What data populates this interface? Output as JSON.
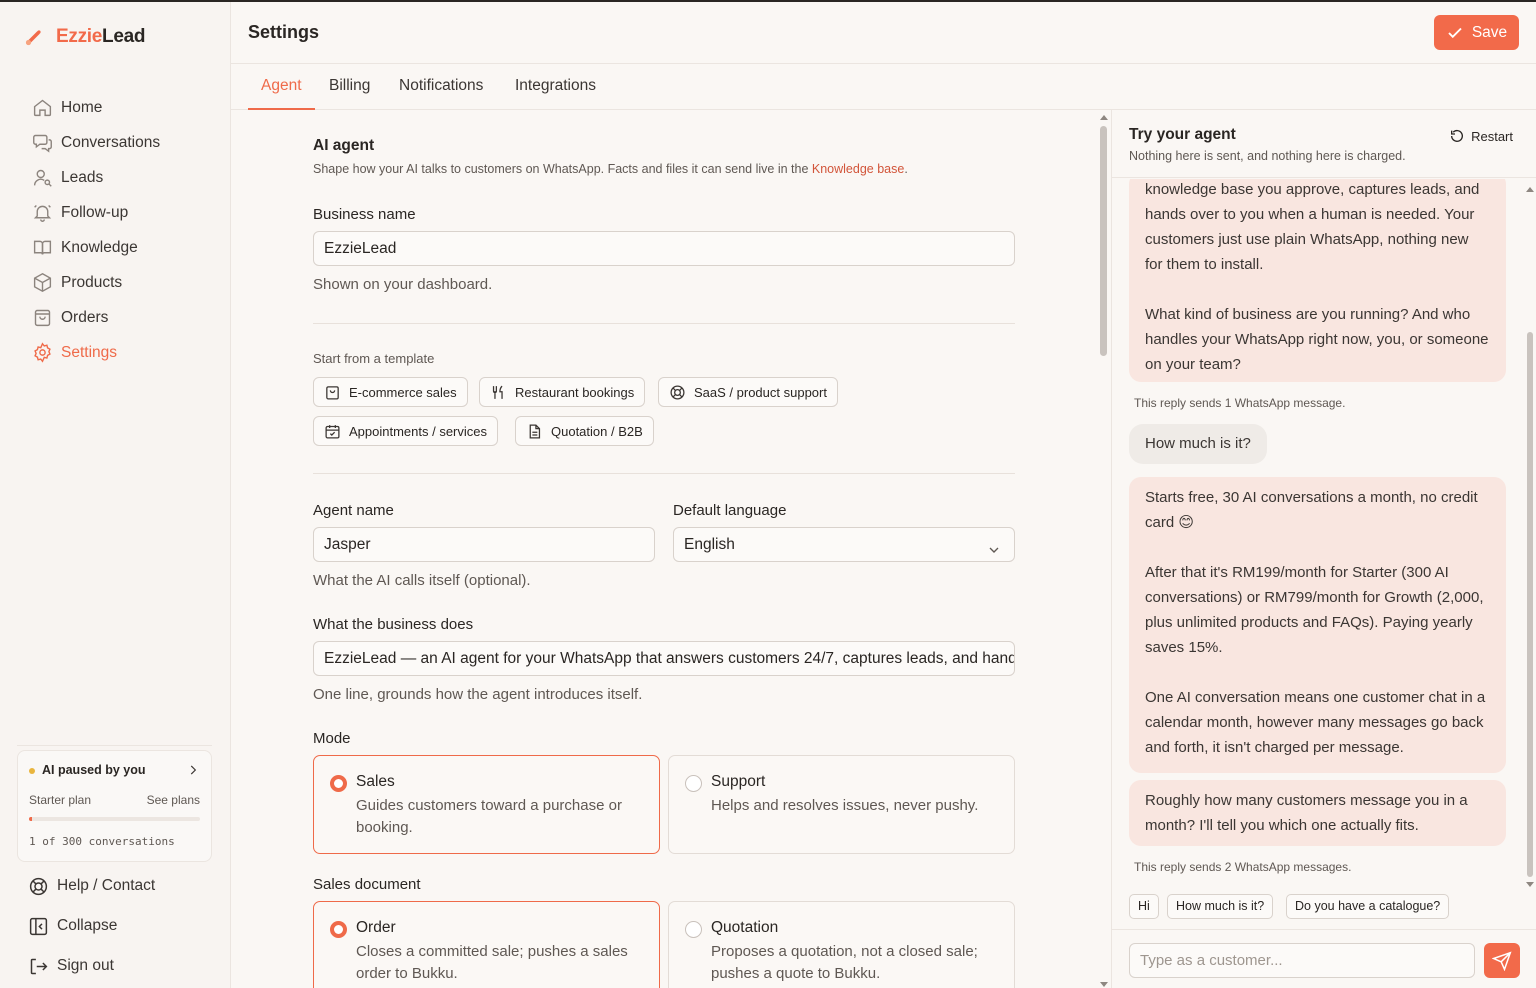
{
  "brand": {
    "name_part1": "Ezzie",
    "name_part2": "Lead",
    "accent": "#f26a4a"
  },
  "sidebar": {
    "items": [
      {
        "label": "Home",
        "icon": "home-icon"
      },
      {
        "label": "Conversations",
        "icon": "chat-icon"
      },
      {
        "label": "Leads",
        "icon": "user-search-icon"
      },
      {
        "label": "Follow-up",
        "icon": "bell-icon"
      },
      {
        "label": "Knowledge",
        "icon": "book-icon"
      },
      {
        "label": "Products",
        "icon": "box-icon"
      },
      {
        "label": "Orders",
        "icon": "bag-icon"
      },
      {
        "label": "Settings",
        "icon": "gear-icon",
        "active": true
      }
    ],
    "plan_card": {
      "status": "AI paused by you",
      "plan": "Starter plan",
      "see_plans": "See plans",
      "usage_text": "1 of 300 conversations",
      "usage_fraction": 0.0033
    },
    "bottom": [
      {
        "label": "Help / Contact",
        "icon": "lifebuoy-icon"
      },
      {
        "label": "Collapse",
        "icon": "collapse-icon"
      },
      {
        "label": "Sign out",
        "icon": "sign-out-icon"
      }
    ]
  },
  "header": {
    "title": "Settings",
    "save_label": "Save"
  },
  "tabs": [
    "Agent",
    "Billing",
    "Notifications",
    "Integrations"
  ],
  "form": {
    "section_title": "AI agent",
    "section_desc": "Shape how your AI talks to customers on WhatsApp. Facts and files it can send live in the ",
    "section_link": "Knowledge base",
    "section_desc_end": ".",
    "business_name_label": "Business name",
    "business_name_value": "EzzieLead",
    "business_name_hint": "Shown on your dashboard.",
    "template_label": "Start from a template",
    "templates": [
      {
        "label": "E-commerce sales",
        "icon": "shopping-bag-icon"
      },
      {
        "label": "Restaurant bookings",
        "icon": "utensils-icon"
      },
      {
        "label": "SaaS / product support",
        "icon": "lifebuoy-icon"
      },
      {
        "label": "Appointments / services",
        "icon": "calendar-icon"
      },
      {
        "label": "Quotation / B2B",
        "icon": "document-icon"
      }
    ],
    "agent_name_label": "Agent name",
    "agent_name_value": "Jasper",
    "agent_name_hint": "What the AI calls itself (optional).",
    "language_label": "Default language",
    "language_value": "English",
    "business_does_label": "What the business does",
    "business_does_value": "EzzieLead — an AI agent for your WhatsApp that answers customers 24/7, captures leads, and hand",
    "business_does_hint": "One line, grounds how the agent introduces itself.",
    "mode_label": "Mode",
    "mode_options": [
      {
        "title": "Sales",
        "desc": "Guides customers toward a purchase or booking.",
        "selected": true
      },
      {
        "title": "Support",
        "desc": "Helps and resolves issues, never pushy.",
        "selected": false
      }
    ],
    "sales_doc_label": "Sales document",
    "sales_doc_options": [
      {
        "title": "Order",
        "desc": "Closes a committed sale; pushes a sales order to Bukku.",
        "selected": true
      },
      {
        "title": "Quotation",
        "desc": "Proposes a quotation, not a closed sale; pushes a quote to Bukku.",
        "selected": false
      }
    ]
  },
  "panel": {
    "title": "Try your agent",
    "subtitle": "Nothing here is sent, and nothing here is charged.",
    "restart_label": "Restart",
    "messages": {
      "bot1_p1": "knowledge base you approve, captures leads, and hands over to you when a human is needed. Your customers just use plain WhatsApp, nothing new for them to install.",
      "bot1_p2": "What kind of business are you running? And who handles your WhatsApp right now, you, or someone on your team?",
      "meta1": "This reply sends 1 WhatsApp message.",
      "user1": "How much is it?",
      "bot2_p1": "Starts free, 30 AI conversations a month, no credit card 😊",
      "bot2_p2": "After that it's RM199/month for Starter (300 AI conversations) or RM799/month for Growth (2,000, plus unlimited products and FAQs). Paying yearly saves 15%.",
      "bot2_p3": "One AI conversation means one customer chat in a calendar month, however many messages go back and forth, it isn't charged per message.",
      "bot3": "Roughly how many customers message you in a month? I'll tell you which one actually fits.",
      "meta2": "This reply sends 2 WhatsApp messages."
    },
    "quick_replies": [
      "Hi",
      "How much is it?",
      "Do you have a catalogue?"
    ],
    "composer_placeholder": "Type as a customer..."
  }
}
